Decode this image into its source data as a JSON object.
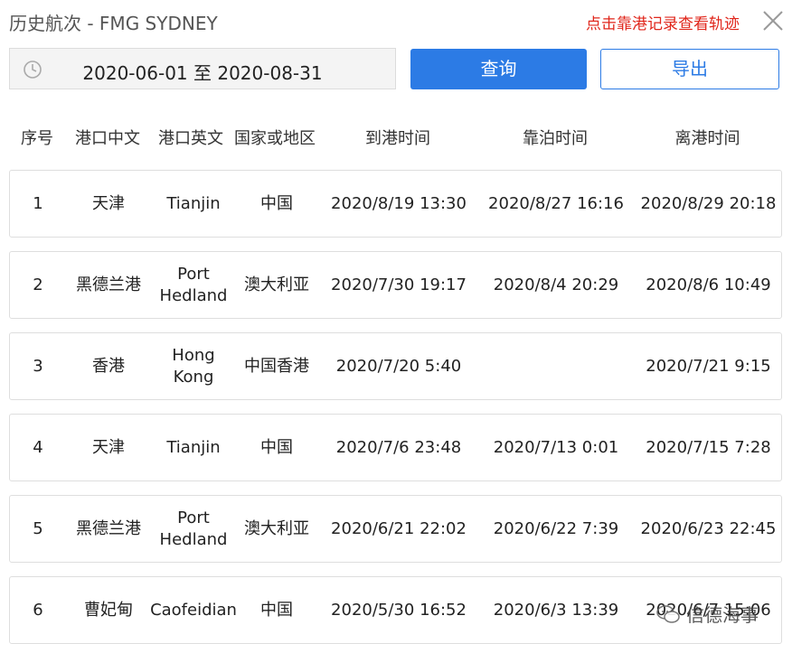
{
  "header": {
    "title": "历史航次 - FMG SYDNEY",
    "hint": "点击靠港记录查看轨迹"
  },
  "toolbar": {
    "date_range": "2020-06-01 至 2020-08-31",
    "query_label": "查询",
    "export_label": "导出"
  },
  "table": {
    "columns": [
      "序号",
      "港口中文",
      "港口英文",
      "国家或地区",
      "到港时间",
      "靠泊时间",
      "离港时间"
    ],
    "rows": [
      {
        "no": "1",
        "port_cn": "天津",
        "port_en": "Tianjin",
        "country": "中国",
        "arrive": "2020/8/19 13:30",
        "berth": "2020/8/27 16:16",
        "depart": "2020/8/29 20:18"
      },
      {
        "no": "2",
        "port_cn": "黑德兰港",
        "port_en": "Port Hedland",
        "country": "澳大利亚",
        "arrive": "2020/7/30 19:17",
        "berth": "2020/8/4 20:29",
        "depart": "2020/8/6 10:49"
      },
      {
        "no": "3",
        "port_cn": "香港",
        "port_en": "Hong Kong",
        "country": "中国香港",
        "arrive": "2020/7/20 5:40",
        "berth": "",
        "depart": "2020/7/21 9:15"
      },
      {
        "no": "4",
        "port_cn": "天津",
        "port_en": "Tianjin",
        "country": "中国",
        "arrive": "2020/7/6 23:48",
        "berth": "2020/7/13 0:01",
        "depart": "2020/7/15 7:28"
      },
      {
        "no": "5",
        "port_cn": "黑德兰港",
        "port_en": "Port Hedland",
        "country": "澳大利亚",
        "arrive": "2020/6/21 22:02",
        "berth": "2020/6/22 7:39",
        "depart": "2020/6/23 22:45"
      },
      {
        "no": "6",
        "port_cn": "曹妃甸",
        "port_en": "Caofeidian",
        "country": "中国",
        "arrive": "2020/5/30 16:52",
        "berth": "2020/6/3 13:39",
        "depart": "2020/6/7 15:06"
      }
    ]
  },
  "watermark": {
    "text": "信德海事",
    "icon": "wechat-icon"
  },
  "colors": {
    "accent": "#2c7be5",
    "hint": "#e0261b"
  }
}
